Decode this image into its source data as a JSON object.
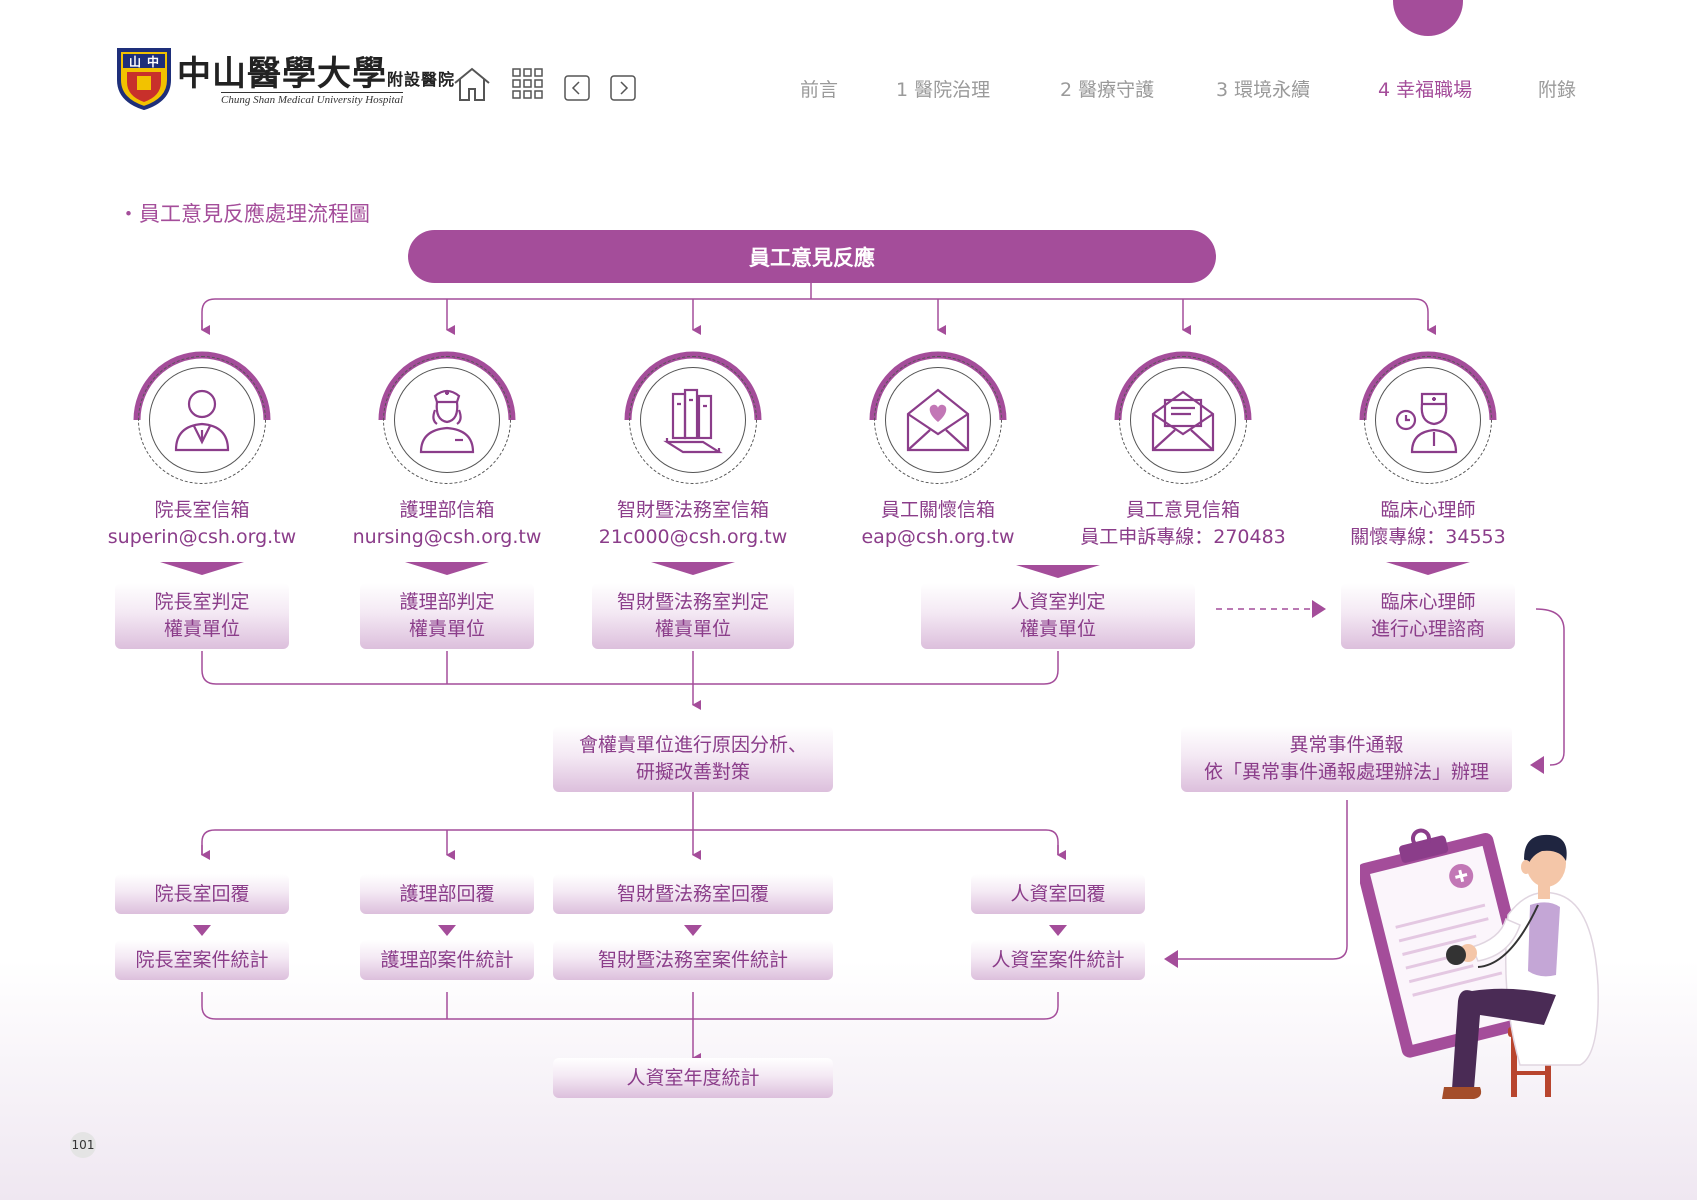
{
  "header": {
    "logo_badge": "山中",
    "logo_name": "中山醫學大學",
    "logo_name_suffix": "附設醫院",
    "logo_sub": "Chung Shan Medical University Hospital",
    "nav": [
      "前言",
      "1 醫院治理",
      "2 醫療守護",
      "3 環境永續",
      "4 幸福職場",
      "附錄"
    ],
    "active_nav": "4 幸福職場",
    "icons": [
      "home-icon",
      "grid-icon",
      "prev-page-icon",
      "next-page-icon"
    ]
  },
  "section_title": "・員工意見反應處理流程圖",
  "diagram": {
    "top": "員工意見反應",
    "channels": [
      {
        "icon": "director-icon",
        "name": "院長室信箱",
        "contact": "superin@csh.org.tw"
      },
      {
        "icon": "nurse-icon",
        "name": "護理部信箱",
        "contact": "nursing@csh.org.tw"
      },
      {
        "icon": "law-books-icon",
        "name": "智財暨法務室信箱",
        "contact": "21c000@csh.org.tw"
      },
      {
        "icon": "heart-mail-icon",
        "name": "員工關懷信箱",
        "contact": "eap@csh.org.tw"
      },
      {
        "icon": "open-mail-icon",
        "name": "員工意見信箱",
        "contact": "員工申訴專線：270483"
      },
      {
        "icon": "psychologist-icon",
        "name": "臨床心理師",
        "contact": "關懷專線：34553"
      }
    ],
    "judge": [
      [
        "院長室判定",
        "權責單位"
      ],
      [
        "護理部判定",
        "權責單位"
      ],
      [
        "智財暨法務室判定",
        "權責單位"
      ],
      [
        "人資室判定",
        "權責單位"
      ],
      [
        "臨床心理師",
        "進行心理諮商"
      ]
    ],
    "analysis": [
      "會權責單位進行原因分析、",
      "研擬改善對策"
    ],
    "abnormal": [
      "異常事件通報",
      "依「異常事件通報處理辦法」辦理"
    ],
    "replies": [
      "院長室回覆",
      "護理部回覆",
      "智財暨法務室回覆",
      "人資室回覆"
    ],
    "stats": [
      "院長室案件統計",
      "護理部案件統計",
      "智財暨法務室案件統計",
      "人資室案件統計"
    ],
    "final": "人資室年度統計"
  },
  "page_number": "101",
  "colors": {
    "accent": "#a44d9a",
    "text": "#8b3d8a",
    "nav_inactive": "#9a9a9a"
  }
}
